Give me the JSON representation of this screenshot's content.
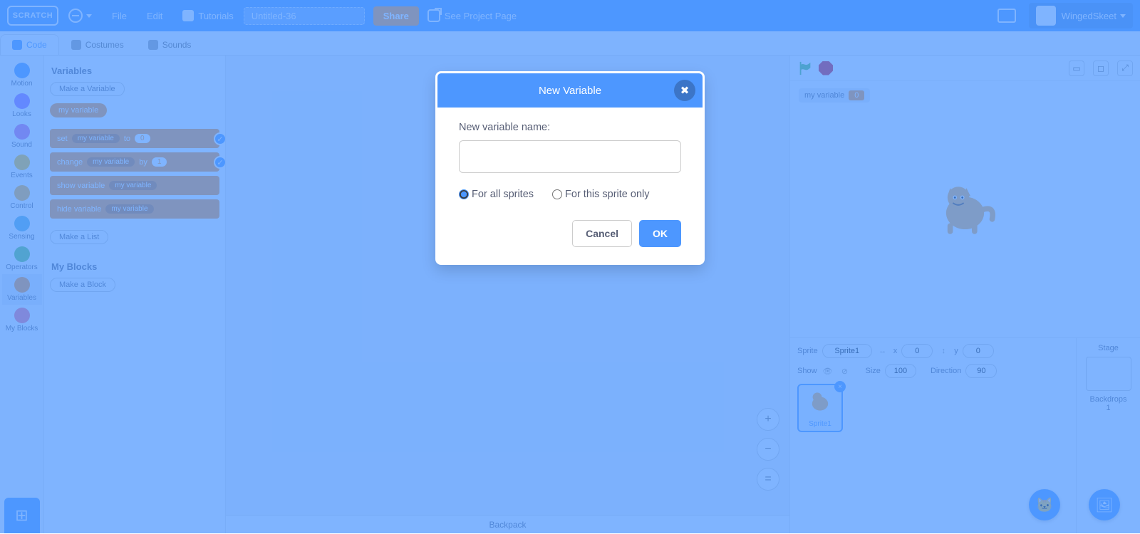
{
  "menubar": {
    "logo_text": "SCRATCH",
    "file": "File",
    "edit": "Edit",
    "tutorials": "Tutorials",
    "project_title": "Untitled-36",
    "share": "Share",
    "see_project": "See Project Page",
    "username": "WingedSkeet"
  },
  "tabs": {
    "code": "Code",
    "costumes": "Costumes",
    "sounds": "Sounds"
  },
  "categories": [
    {
      "name": "Motion",
      "color": "#4c97ff"
    },
    {
      "name": "Looks",
      "color": "#9966ff"
    },
    {
      "name": "Sound",
      "color": "#cf63cf"
    },
    {
      "name": "Events",
      "color": "#ffbf00"
    },
    {
      "name": "Control",
      "color": "#ffab19"
    },
    {
      "name": "Sensing",
      "color": "#5cb1d6"
    },
    {
      "name": "Operators",
      "color": "#59c059"
    },
    {
      "name": "Variables",
      "color": "#ff8c1a"
    },
    {
      "name": "My Blocks",
      "color": "#ff6680"
    }
  ],
  "palette": {
    "variables_heading": "Variables",
    "make_variable": "Make a Variable",
    "var_name": "my variable",
    "block_set": "set",
    "block_to": "to",
    "block_set_val": "0",
    "block_change": "change",
    "block_by": "by",
    "block_change_val": "1",
    "block_show": "show variable",
    "block_hide": "hide variable",
    "make_list": "Make a List",
    "myblocks_heading": "My Blocks",
    "make_block": "Make a Block"
  },
  "backpack": "Backpack",
  "stage_readout": {
    "label": "my variable",
    "value": "0"
  },
  "sprite_info": {
    "sprite_label": "Sprite",
    "sprite_name": "Sprite1",
    "x_label": "x",
    "x_val": "0",
    "y_label": "y",
    "y_val": "0",
    "show_label": "Show",
    "size_label": "Size",
    "size_val": "100",
    "dir_label": "Direction",
    "dir_val": "90",
    "tile_name": "Sprite1",
    "stage_label": "Stage",
    "backdrops_label": "Backdrops",
    "backdrops_count": "1"
  },
  "modal": {
    "title": "New Variable",
    "field_label": "New variable name:",
    "input_value": "",
    "scope_all": "For all sprites",
    "scope_this": "For this sprite only",
    "cancel": "Cancel",
    "ok": "OK"
  }
}
